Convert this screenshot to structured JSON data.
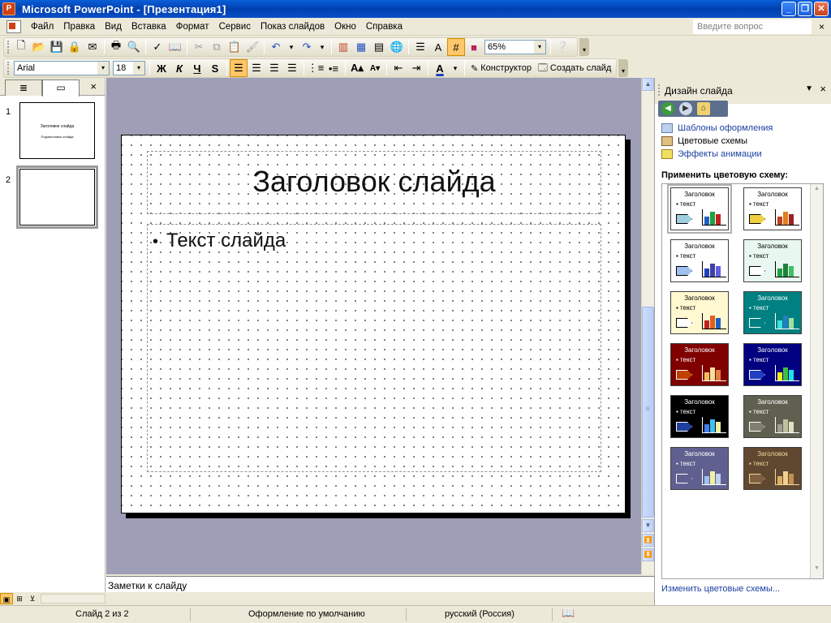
{
  "app": {
    "title": "Microsoft PowerPoint - [Презентация1]",
    "window_buttons": [
      "_",
      "❐",
      "✕"
    ]
  },
  "menu": {
    "items": [
      "Файл",
      "Правка",
      "Вид",
      "Вставка",
      "Формат",
      "Сервис",
      "Показ слайдов",
      "Окно",
      "Справка"
    ],
    "help_placeholder": "Введите вопрос",
    "close": "×"
  },
  "standard_toolbar": {
    "zoom": "65%",
    "zoom_arrow": "▾"
  },
  "format_toolbar": {
    "font": "Arial",
    "size": "18",
    "bold": "Ж",
    "italic": "К",
    "underline": "Ч",
    "shadow": "S",
    "designer": "Конструктор",
    "new_slide": "Создать слайд"
  },
  "slides_pane": {
    "close": "×",
    "thumbnails": [
      {
        "number": "1",
        "title": "Заголовок слайда",
        "subtitle": "Подзаголовок слайда"
      },
      {
        "number": "2"
      }
    ]
  },
  "slide": {
    "title": "Заголовок слайда",
    "body_bullet": "•",
    "body_text": "Текст слайда"
  },
  "notes": {
    "placeholder": "Заметки к слайду"
  },
  "task_pane": {
    "title": "Дизайн слайда",
    "menu_arrow": "▼",
    "close": "×",
    "links": [
      "Шаблоны оформления",
      "Цветовые схемы",
      "Эффекты анимации"
    ],
    "apply_label": "Применить цветовую схему:",
    "footer_link": "Изменить цветовые схемы...",
    "schemes": [
      {
        "title": "Заголовок",
        "text": "▪ текст",
        "bg": "#ffffff",
        "fg": "#000000",
        "arrow": "#a0d0e0",
        "bars": [
          "#2060c0",
          "#20a040",
          "#c02020"
        ]
      },
      {
        "title": "Заголовок",
        "text": "▪ текст",
        "bg": "#ffffff",
        "fg": "#000000",
        "arrow": "#f0d040",
        "bars": [
          "#c04020",
          "#e08020",
          "#a02020"
        ]
      },
      {
        "title": "Заголовок",
        "text": "▪ текст",
        "bg": "#ffffff",
        "fg": "#000000",
        "arrow": "#a0c0f0",
        "bars": [
          "#2040c0",
          "#4040a0",
          "#6060e0"
        ]
      },
      {
        "title": "Заголовок",
        "text": "▪ текст",
        "bg": "#e8f8f0",
        "fg": "#000000",
        "arrow": "#ffffff",
        "bars": [
          "#20a040",
          "#208040",
          "#40c060"
        ]
      },
      {
        "title": "Заголовок",
        "text": "▪ текст",
        "bg": "#fff8d0",
        "fg": "#000000",
        "arrow": "#ffffff",
        "bars": [
          "#c02020",
          "#e06020",
          "#2060c0"
        ]
      },
      {
        "title": "Заголовок",
        "text": "▪ текст",
        "bg": "#008080",
        "fg": "#ffffff",
        "arrow": "#008080",
        "bars": [
          "#40e0e0",
          "#2080c0",
          "#a0e0a0"
        ]
      },
      {
        "title": "Заголовок",
        "text": "▪ текст",
        "bg": "#800000",
        "fg": "#ffffff",
        "arrow": "#c04000",
        "bars": [
          "#f0c060",
          "#f0e0a0",
          "#e08040"
        ]
      },
      {
        "title": "Заголовок",
        "text": "▪ текст",
        "bg": "#000080",
        "fg": "#ffffff",
        "arrow": "#2040c0",
        "bars": [
          "#f0f020",
          "#40c040",
          "#20e0e0"
        ]
      },
      {
        "title": "Заголовок",
        "text": "▪ текст",
        "bg": "#000000",
        "fg": "#ffffff",
        "arrow": "#2040a0",
        "bars": [
          "#4080f0",
          "#40c0f0",
          "#f0f0a0"
        ]
      },
      {
        "title": "Заголовок",
        "text": "▪ текст",
        "bg": "#606050",
        "fg": "#ffffff",
        "arrow": "#808070",
        "bars": [
          "#a0a090",
          "#c0c0a0",
          "#e0e0c0"
        ]
      },
      {
        "title": "Заголовок",
        "text": "▪ текст",
        "bg": "#606090",
        "fg": "#ffffff",
        "arrow": "#606090",
        "bars": [
          "#a0c0f0",
          "#f0f0a0",
          "#c0d0f0"
        ]
      },
      {
        "title": "Заголовок",
        "text": "▪ текст",
        "bg": "#604830",
        "fg": "#f0d8a0",
        "arrow": "#806040",
        "bars": [
          "#e0b060",
          "#f0d090",
          "#c09050"
        ]
      }
    ]
  },
  "status_bar": {
    "slide_count": "Слайд 2 из 2",
    "design": "Оформление по умолчанию",
    "language": "русский (Россия)"
  }
}
